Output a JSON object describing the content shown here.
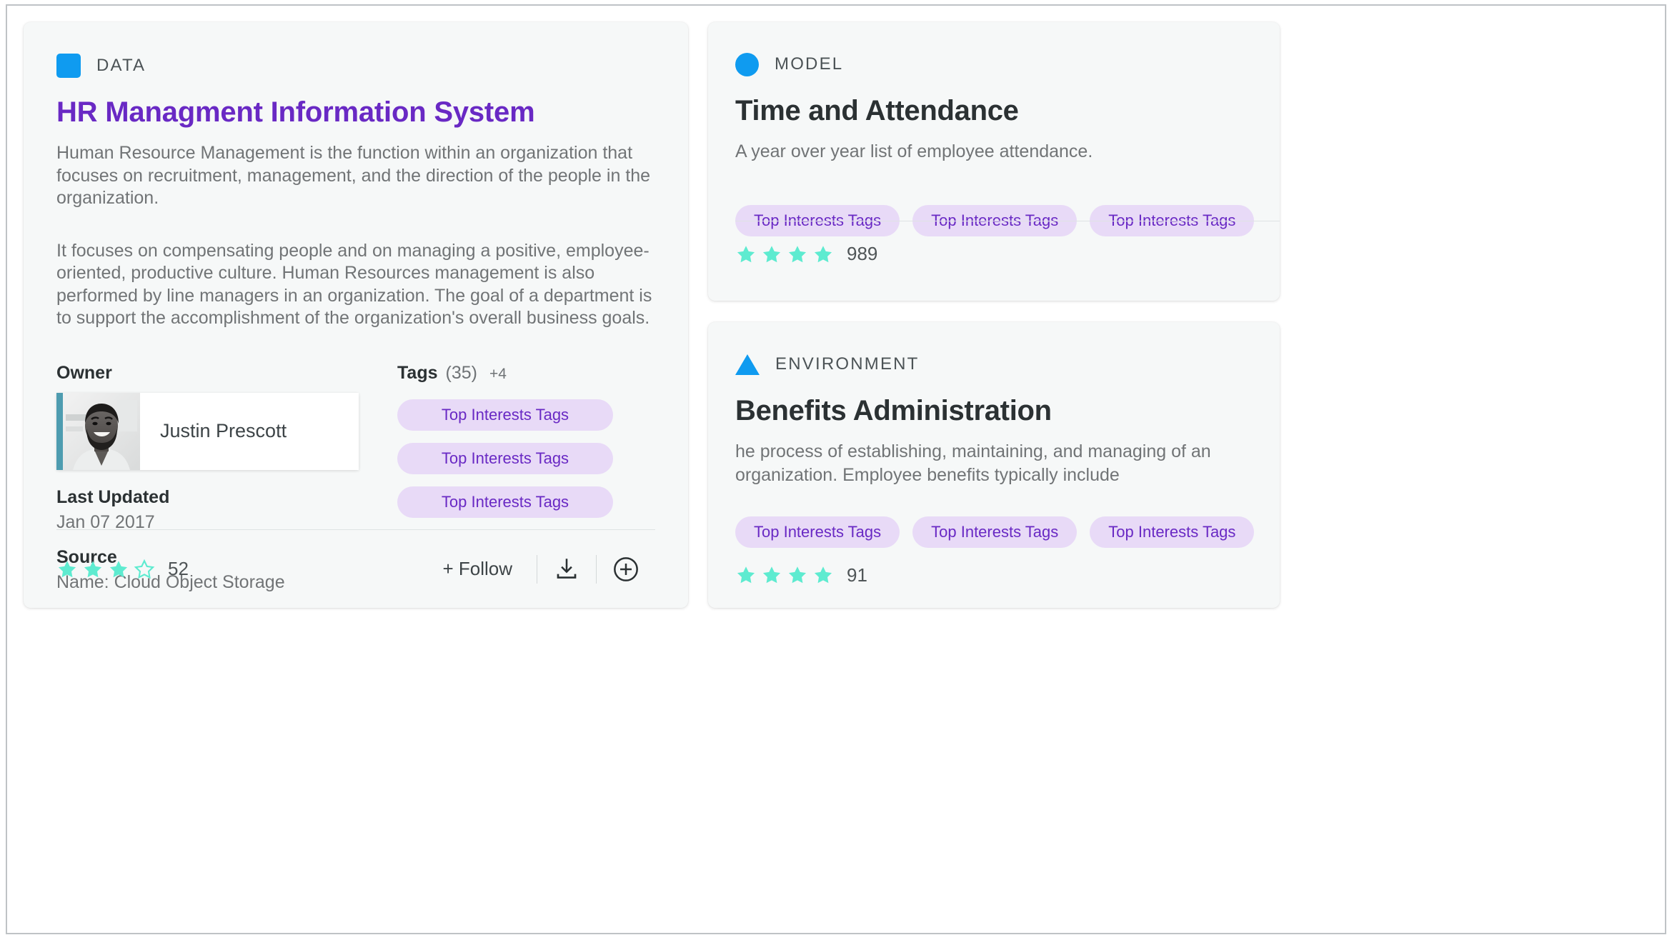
{
  "main_card": {
    "kind_badge": {
      "icon": "square-badge-icon",
      "label": "DATA",
      "color": "#0f9bf0"
    },
    "title": "HR Managment Information System",
    "paragraph_1": "Human Resource Management is the function within an organization that focuses on recruitment, management, and the direction of the people in the organization.",
    "paragraph_2": "It focuses on compensating people and on managing a positive, employee-oriented, productive culture.  Human Resources management is also performed by line managers in an organization. The goal of a department is to support the accomplishment of the organization's overall business goals.",
    "owner": {
      "label": "Owner",
      "name": "Justin Prescott",
      "accent_color": "#4e9cb0"
    },
    "last_updated": {
      "label": "Last Updated",
      "value": "Jan 07 2017"
    },
    "source": {
      "label": "Source",
      "value": "Name: Cloud Object Storage"
    },
    "tags": {
      "label": "Tags",
      "count": "(35)",
      "more": "+4",
      "items": [
        "Top Interests Tags",
        "Top Interests Tags",
        "Top Interests Tags"
      ]
    },
    "footer": {
      "rating": {
        "filled": 3,
        "total": 4,
        "count": "52",
        "color": "#5eebd0"
      },
      "follow_label": "+ Follow",
      "download_icon": "download-icon",
      "add_icon": "plus-circle-icon"
    }
  },
  "side_cards": [
    {
      "kind_badge": {
        "icon": "circle-badge-icon",
        "label": "MODEL",
        "color": "#0f9bf0"
      },
      "title": "Time and Attendance",
      "description": "A year over year list of employee attendance.",
      "tags": [
        "Top Interests Tags",
        "Top Interests Tags",
        "Top Interests Tags"
      ],
      "rating": {
        "filled": 4,
        "total": 4,
        "count": "989",
        "color": "#5eebd0"
      }
    },
    {
      "kind_badge": {
        "icon": "triangle-badge-icon",
        "label": "ENVIRONMENT",
        "color": "#0f9bf0"
      },
      "title": "Benefits Administration",
      "description": "he process of establishing, maintaining, and managing of an organization. Employee benefits typically include",
      "tags": [
        "Top Interests Tags",
        "Top Interests Tags",
        "Top Interests Tags"
      ],
      "rating": {
        "filled": 4,
        "total": 4,
        "count": "91",
        "color": "#5eebd0"
      }
    }
  ],
  "theme": {
    "accent_blue": "#0f9bf0",
    "title_purple": "#6929c4",
    "tag_bg": "#e8daf7",
    "tag_text": "#6929c4",
    "star_mint": "#5eebd0",
    "card_bg": "#f6f8f8"
  }
}
